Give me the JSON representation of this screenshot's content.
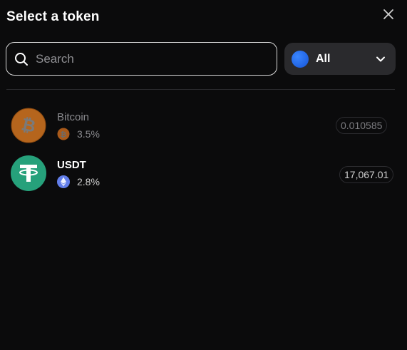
{
  "header": {
    "title": "Select a token"
  },
  "search": {
    "placeholder": "Search",
    "value": ""
  },
  "network_filter": {
    "selected": "All",
    "color": "#1f6bff"
  },
  "tokens": [
    {
      "name": "Bitcoin",
      "percent": "3.5%",
      "balance": "0.010585",
      "chain_icon": "bitcoin-icon",
      "logo": "bitcoin-logo",
      "color": "#c56a1a"
    },
    {
      "name": "USDT",
      "percent": "2.8%",
      "balance": "17,067.01",
      "chain_icon": "ethereum-icon",
      "logo": "tether-logo",
      "color": "#26a17b"
    }
  ]
}
